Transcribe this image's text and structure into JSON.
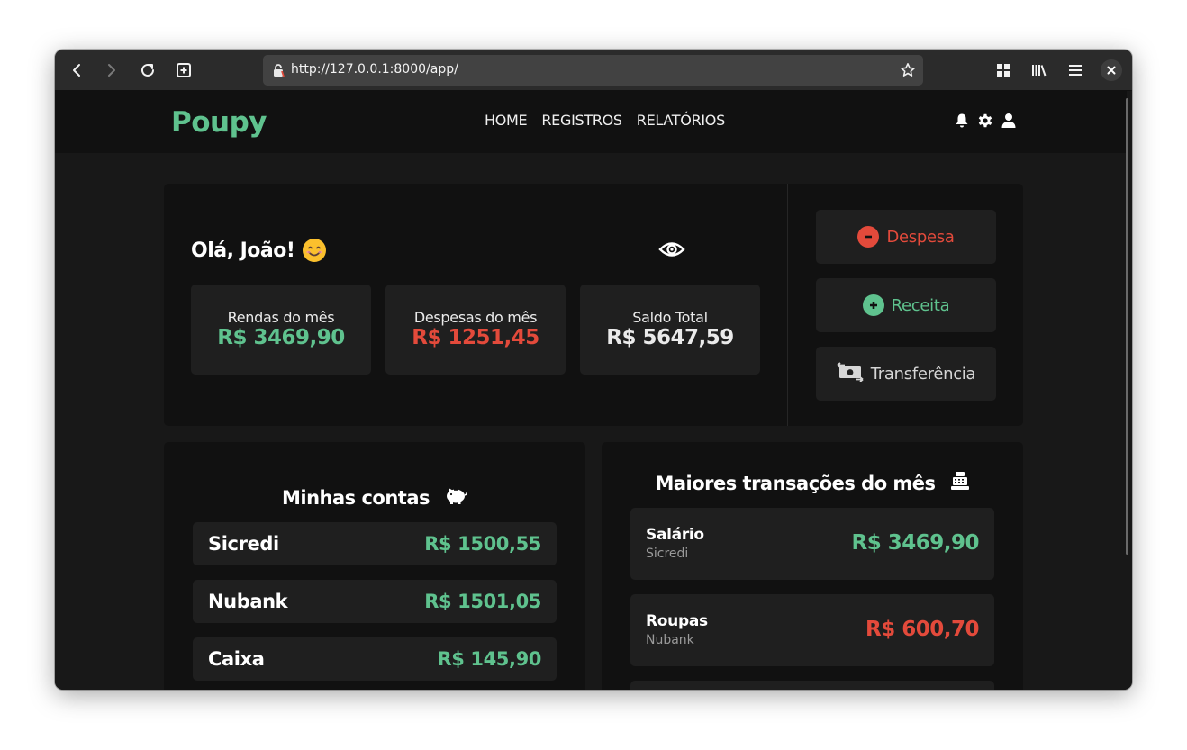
{
  "browser": {
    "url": "http://127.0.0.1:8000/app/"
  },
  "navbar": {
    "brand": "Poupy",
    "links": [
      "HOME",
      "REGISTROS",
      "RELATÓRIOS"
    ]
  },
  "summary": {
    "greeting": "Olá, João!",
    "stats": [
      {
        "label": "Rendas do mês",
        "value": "R$ 3469,90",
        "color": "#5fc28e"
      },
      {
        "label": "Despesas do mês",
        "value": "R$ 1251,45",
        "color": "#e34a3b"
      },
      {
        "label": "Saldo Total",
        "value": "R$ 5647,59",
        "color": "#eaeaea"
      }
    ],
    "actions": [
      {
        "label": "Despesa",
        "icon": "minus-circle-icon",
        "color": "#e34a3b"
      },
      {
        "label": "Receita",
        "icon": "plus-circle-icon",
        "color": "#5fc28e"
      },
      {
        "label": "Transferência",
        "icon": "money-transfer-icon",
        "color": "#d6d6d6"
      }
    ]
  },
  "accounts": {
    "title": "Minhas contas",
    "icon": "piggy-bank-icon",
    "items": [
      {
        "name": "Sicredi",
        "value": "R$ 1500,55"
      },
      {
        "name": "Nubank",
        "value": "R$ 1501,05"
      },
      {
        "name": "Caixa",
        "value": "R$ 145,90"
      }
    ]
  },
  "transactions": {
    "title": "Maiores transações do mês",
    "icon": "cash-register-icon",
    "items": [
      {
        "name": "Salário",
        "account": "Sicredi",
        "value": "R$ 3469,90",
        "color": "#5fc28e"
      },
      {
        "name": "Roupas",
        "account": "Nubank",
        "value": "R$ 600,70",
        "color": "#e34a3b"
      }
    ]
  },
  "colors": {
    "brand": "#5fc28e",
    "income": "#5fc28e",
    "expense": "#e34a3b",
    "card_bg": "#111111",
    "tile_bg": "#1f1f1f"
  }
}
